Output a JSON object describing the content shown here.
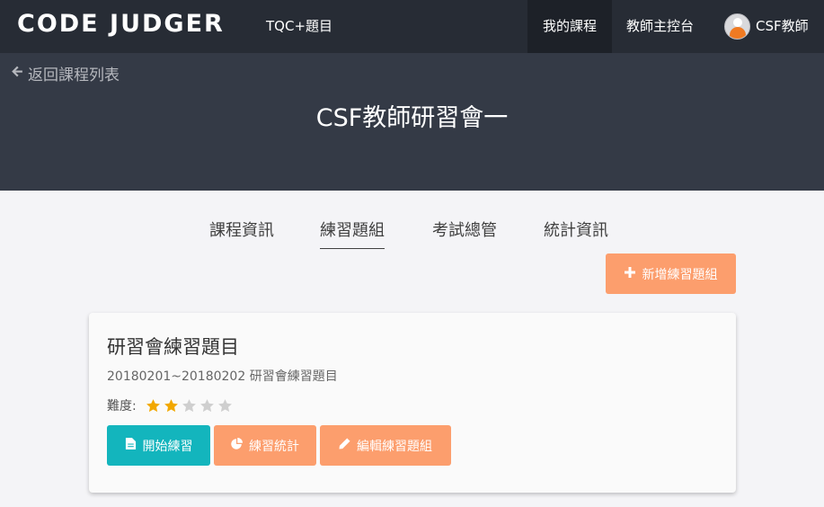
{
  "navbar": {
    "logo": "CODE JUDGER",
    "tqc_link": "TQC+題目",
    "my_courses": "我的課程",
    "teacher_console": "教師主控台",
    "user_name": "CSF教師"
  },
  "hero": {
    "back_link": "返回課程列表",
    "title": "CSF教師研習會一"
  },
  "tabs": {
    "course_info": "課程資訊",
    "practice_sets": "練習題組",
    "exam_management": "考試總管",
    "statistics": "統計資訊",
    "active": "練習題組"
  },
  "add_button": "新增練習題組",
  "card": {
    "title": "研習會練習題目",
    "subtitle": "20180201~20180202 研習會練習題目",
    "difficulty_label": "難度:",
    "difficulty": 2,
    "difficulty_max": 5,
    "actions": {
      "start": "開始練習",
      "stats": "練習統計",
      "edit": "編輯練習題組"
    }
  },
  "colors": {
    "navbar_bg": "#272c35",
    "hero_bg": "#343a46",
    "accent_orange": "#fc9e6d",
    "accent_teal": "#13b5bd",
    "star_filled": "#f2a800",
    "star_empty": "#cfcfcf"
  },
  "icons": {
    "back": "arrow-left-icon",
    "add": "plus-icon",
    "start": "file-icon",
    "stats": "pie-chart-icon",
    "edit": "pencil-icon"
  }
}
